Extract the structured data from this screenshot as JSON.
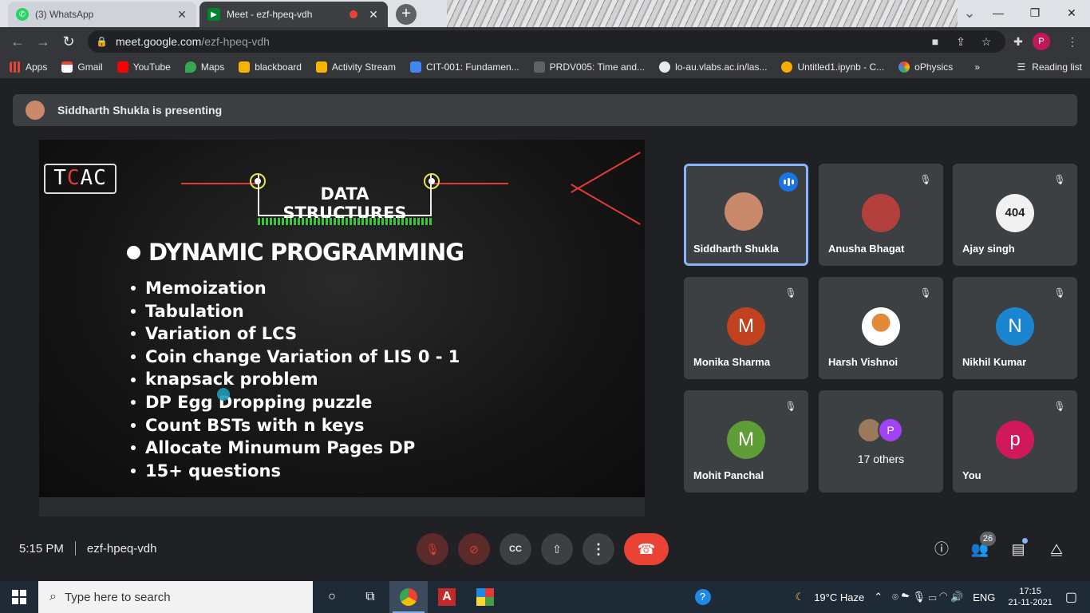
{
  "browser": {
    "tabs": [
      {
        "title": "(3) WhatsApp",
        "icon": "whatsapp-icon",
        "active": false
      },
      {
        "title": "Meet - ezf-hpeq-vdh",
        "icon": "meet-icon",
        "active": true
      }
    ],
    "url_host": "meet.google.com",
    "url_path": "/ezf-hpeq-vdh",
    "profile_initial": "P",
    "bookmarks": [
      "Apps",
      "Gmail",
      "YouTube",
      "Maps",
      "blackboard",
      "Activity Stream",
      "CIT-001: Fundamen...",
      "PRDV005: Time and...",
      "lo-au.vlabs.ac.in/las...",
      "Untitled1.ipynb - C...",
      "oPhysics"
    ],
    "bookmark_overflow": "»",
    "reading_list": "Reading list"
  },
  "meet": {
    "presenting_text": "Siddharth Shukla is presenting",
    "slide": {
      "logo": {
        "left": "T",
        "mid": "C",
        "right": "AC"
      },
      "title": "DATA STRUCTURES",
      "heading": "DYNAMIC PROGRAMMING",
      "items": [
        "Memoization",
        "Tabulation",
        "Variation of LCS",
        "Coin change Variation of LIS 0 - 1",
        "knapsack problem",
        "DP Egg Dropping puzzle",
        "Count BSTs with n keys",
        "Allocate Minumum Pages DP",
        "15+ questions"
      ]
    },
    "participants": [
      {
        "name": "Siddharth Shukla",
        "initial": "",
        "color": "#c98a6b",
        "speaking": true
      },
      {
        "name": "Anusha Bhagat",
        "initial": "",
        "color": "#b3403d",
        "speaking": false
      },
      {
        "name": "Ajay singh",
        "initial": "404",
        "color": "#f1f1f1",
        "speaking": false
      },
      {
        "name": "Monika Sharma",
        "initial": "M",
        "color": "#c0421f",
        "speaking": false
      },
      {
        "name": "Harsh Vishnoi",
        "initial": "",
        "color": "#e08a3a",
        "speaking": false
      },
      {
        "name": "Nikhil Kumar",
        "initial": "N",
        "color": "#1a86d0",
        "speaking": false
      },
      {
        "name": "Mohit Panchal",
        "initial": "M",
        "color": "#5f9e36",
        "speaking": false
      },
      {
        "name": "You",
        "initial": "p",
        "color": "#d0195b",
        "speaking": false
      }
    ],
    "others": {
      "label": "17 others",
      "avatar_initial": "P"
    },
    "time": "5:15 PM",
    "meeting_code": "ezf-hpeq-vdh",
    "people_count": "26"
  },
  "taskbar": {
    "search_placeholder": "Type here to search",
    "weather": "19°C  Haze",
    "lang": "ENG",
    "clock_time": "17:15",
    "clock_date": "21-11-2021"
  }
}
